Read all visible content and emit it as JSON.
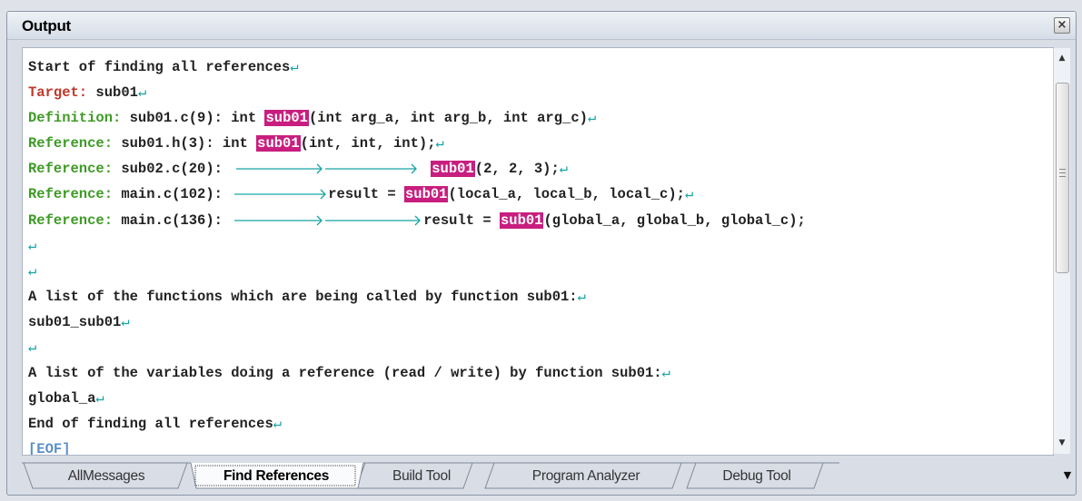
{
  "window": {
    "title": "Output"
  },
  "icons": {
    "close": "close-icon",
    "scroll_up": "scroll-up-arrow-icon",
    "scroll_down": "scroll-down-arrow-icon",
    "tab_menu": "tab-list-dropdown-icon",
    "tab_char": "tab-arrow-icon",
    "return_char": "carriage-return-icon"
  },
  "colors": {
    "highlight": "#c81e7f",
    "target": "#c0392b",
    "label_green": "#3e9b26",
    "return_mark": "#17a3a3",
    "eof": "#5a8fc6"
  },
  "output": {
    "l1": "Start of finding all references",
    "l2_label": "Target:",
    "l2_rest": " sub01",
    "l3_label": "Definition:",
    "l3_pre": " sub01.c(9): int ",
    "l3_hl": "sub01",
    "l3_post": "(int arg_a, int arg_b, int arg_c)",
    "l4_label": "Reference:",
    "l4_pre": " sub01.h(3): int ",
    "l4_hl": "sub01",
    "l4_post": "(int, int, int);",
    "l5_label": "Reference:",
    "l5_pre": " sub02.c(20): ",
    "l5_hl": "sub01",
    "l5_post": "(2, 2, 3);",
    "l6_label": "Reference:",
    "l6_pre": " main.c(102): ",
    "l6_mid": "result = ",
    "l6_hl": "sub01",
    "l6_post": "(local_a, local_b, local_c);",
    "l7_label": "Reference:",
    "l7_pre": " main.c(136): ",
    "l7_mid": "result = ",
    "l7_hl": "sub01",
    "l7_post": "(global_a, global_b, global_c);",
    "l10": "A list of the functions which are being called by function sub01:",
    "l11": "sub01_sub01",
    "l13": "A list of the variables doing a reference (read / write) by function sub01:",
    "l14": "global_a",
    "l15": "End of finding all references",
    "l16": "[EOF]"
  },
  "tabs": {
    "t1": "AllMessages",
    "t2": "Find References",
    "t3": "Build Tool",
    "t4": "Program Analyzer",
    "t5": "Debug Tool",
    "active": "Find References"
  }
}
